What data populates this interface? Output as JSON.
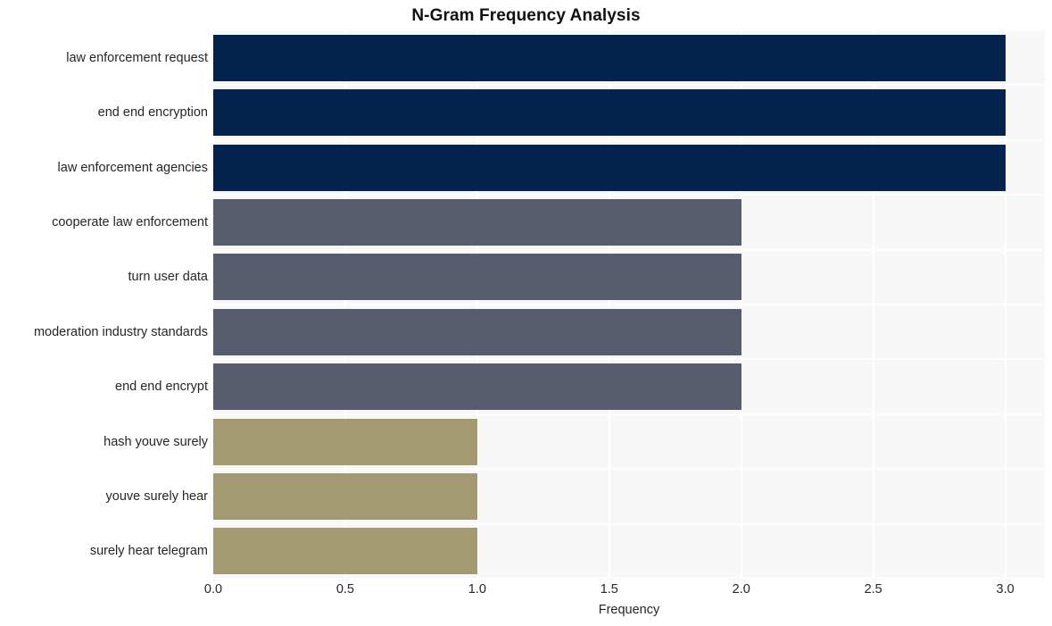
{
  "chart_data": {
    "type": "bar",
    "orientation": "horizontal",
    "title": "N-Gram Frequency Analysis",
    "xlabel": "Frequency",
    "ylabel": "",
    "xlim": [
      0,
      3.15
    ],
    "xticks": [
      "0.0",
      "0.5",
      "1.0",
      "1.5",
      "2.0",
      "2.5",
      "3.0"
    ],
    "xtick_values": [
      0,
      0.5,
      1,
      1.5,
      2,
      2.5,
      3
    ],
    "grid": true,
    "legend": "none",
    "categories": [
      "law enforcement request",
      "end end encryption",
      "law enforcement agencies",
      "cooperate law enforcement",
      "turn user data",
      "moderation industry standards",
      "end end encrypt",
      "hash youve surely",
      "youve surely hear",
      "surely hear telegram"
    ],
    "values": [
      3,
      3,
      3,
      2,
      2,
      2,
      2,
      1,
      1,
      1
    ],
    "bar_colors": [
      "#04244f",
      "#04244f",
      "#04244f",
      "#575c6e",
      "#575c6e",
      "#575c6e",
      "#575c6e",
      "#a39a72",
      "#a39a72",
      "#a39a72"
    ]
  },
  "style": {
    "plot_background": "#f7f7f8",
    "figure_background": "#ffffff",
    "gridline_color": "#ffffff",
    "text_color": "#262626",
    "title_color": "#111111"
  }
}
